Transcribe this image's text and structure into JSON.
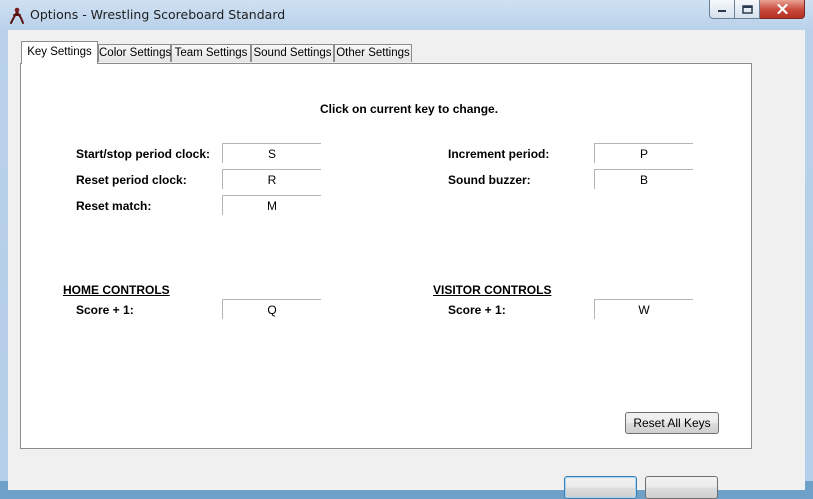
{
  "window": {
    "title": "Options - Wrestling Scoreboard Standard",
    "icons": {
      "app": "wrestler-app-icon",
      "minimize": "minimize-icon",
      "maximize": "maximize-icon",
      "close": "close-icon"
    }
  },
  "tabs": [
    {
      "label": "Key Settings",
      "active": true
    },
    {
      "label": "Color Settings",
      "active": false
    },
    {
      "label": "Team Settings",
      "active": false
    },
    {
      "label": "Sound Settings",
      "active": false
    },
    {
      "label": "Other Settings",
      "active": false
    }
  ],
  "key_settings": {
    "instruction": "Click on current key to change.",
    "general_left": [
      {
        "label": "Start/stop period clock:",
        "key": "S"
      },
      {
        "label": "Reset period clock:",
        "key": "R"
      },
      {
        "label": "Reset match:",
        "key": "M"
      }
    ],
    "general_right": [
      {
        "label": "Increment period:",
        "key": "P"
      },
      {
        "label": "Sound buzzer:",
        "key": "B"
      }
    ],
    "home": {
      "header": "HOME CONTROLS",
      "score_label": "Score + 1:",
      "score_key": "Q"
    },
    "visitor": {
      "header": "VISITOR CONTROLS",
      "score_label": "Score + 1:",
      "score_key": "W"
    },
    "reset_button": "Reset All Keys"
  },
  "dialog_buttons": {
    "ok": "",
    "cancel": ""
  }
}
